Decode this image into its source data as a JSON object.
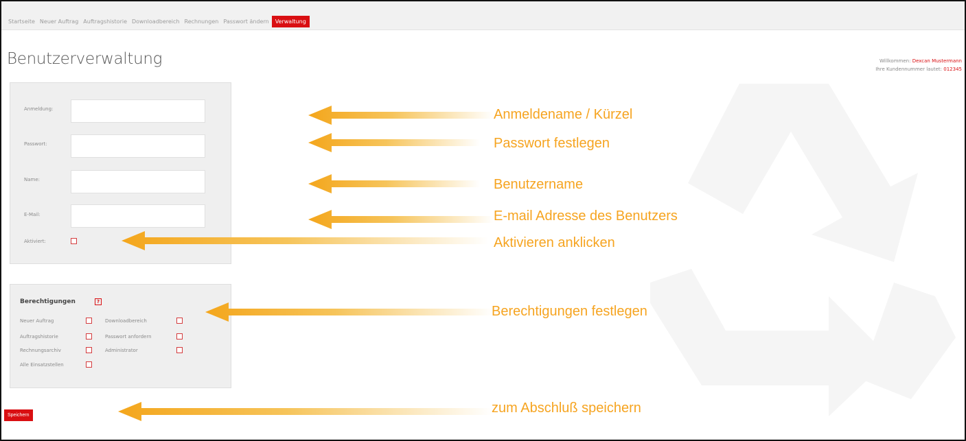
{
  "nav": {
    "items": [
      "Startseite",
      "Neuer Auftrag",
      "Auftragshistorie",
      "Downloadbereich",
      "Rechnungen",
      "Passwort ändern",
      "Verwaltung"
    ],
    "active_index": 6
  },
  "header": {
    "title": "Benutzerverwaltung",
    "welcome_prefix": "Willkommen:",
    "welcome_name": "Dexcan Mustermann",
    "customer_prefix": "Ihre Kundennummer lautet:",
    "customer_number": "012345"
  },
  "form": {
    "login_label": "Anmeldung:",
    "password_label": "Passwort:",
    "name_label": "Name:",
    "email_label": "E-Mail:",
    "activated_label": "Aktiviert:",
    "login_value": "",
    "password_value": "",
    "name_value": "",
    "email_value": ""
  },
  "permissions": {
    "title": "Berechtigungen",
    "help_glyph": "?",
    "new_order": "Neuer Auftrag",
    "download_area": "Downloadbereich",
    "order_history": "Auftragshistorie",
    "request_password": "Passwort anfordern",
    "invoice_archive": "Rechnungsarchiv",
    "administrator": "Administrator",
    "all_cost_centers": "Alle Einsatzstellen"
  },
  "save_label": "Speichern",
  "annotations": {
    "login": "Anmeldename / Kürzel",
    "password": "Passwort festlegen",
    "name": "Benutzername",
    "email": "E-mail Adresse des Benutzers",
    "activate": "Aktivieren anklicken",
    "permissions": "Berechtigungen festlegen",
    "save": "zum Abschluß speichern"
  },
  "colors": {
    "brand_red": "#d90f12",
    "annotation": "#f6a420"
  }
}
